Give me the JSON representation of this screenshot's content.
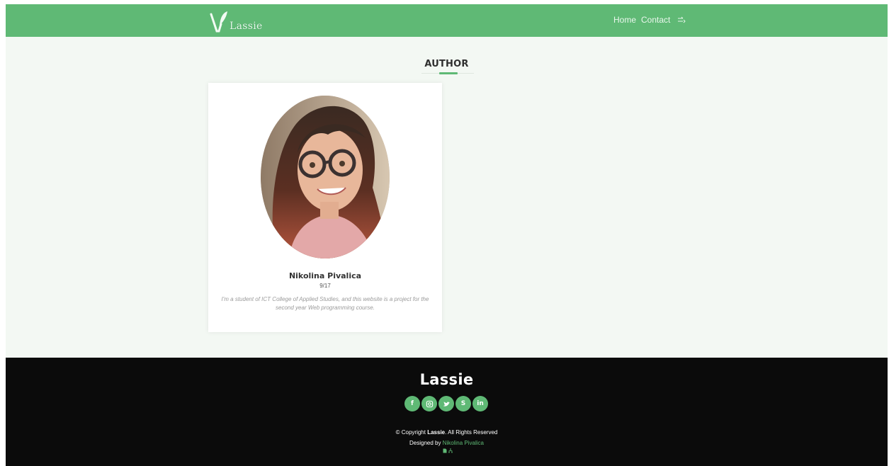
{
  "colors": {
    "brand_green": "#5fb975",
    "footer_bg": "#0b0b0b",
    "page_bg": "#f3f8f3"
  },
  "nav": {
    "logo_text": "Lassie",
    "logo_icon": "leaf-v-logo",
    "links": [
      {
        "label": "Home"
      },
      {
        "label": "Contact"
      }
    ],
    "extra_icon": "login-arrow-icon"
  },
  "section": {
    "title": "AUTHOR"
  },
  "author": {
    "photo_icon": "author-photo",
    "name": "Nikolina Pivalica",
    "index": "9/17",
    "bio": "I'm a student of ICT College of Applied Studies, and this website is a project for the second year Web programming course."
  },
  "footer": {
    "brand": "Lassie",
    "socials": [
      {
        "icon": "facebook-icon",
        "glyph": "f"
      },
      {
        "icon": "instagram-icon",
        "glyph": ""
      },
      {
        "icon": "twitter-icon",
        "glyph": ""
      },
      {
        "icon": "skype-icon",
        "glyph": "S"
      },
      {
        "icon": "linkedin-icon",
        "glyph": "in"
      }
    ],
    "copyright_prefix": "© Copyright",
    "copyright_brand": "Lassie",
    "copyright_suffix": ". All Rights Reserved",
    "designed_prefix": "Designed by",
    "designer_name": "Nikolina Pivalica",
    "mini_icons": [
      "document-icon",
      "sitemap-icon"
    ]
  }
}
